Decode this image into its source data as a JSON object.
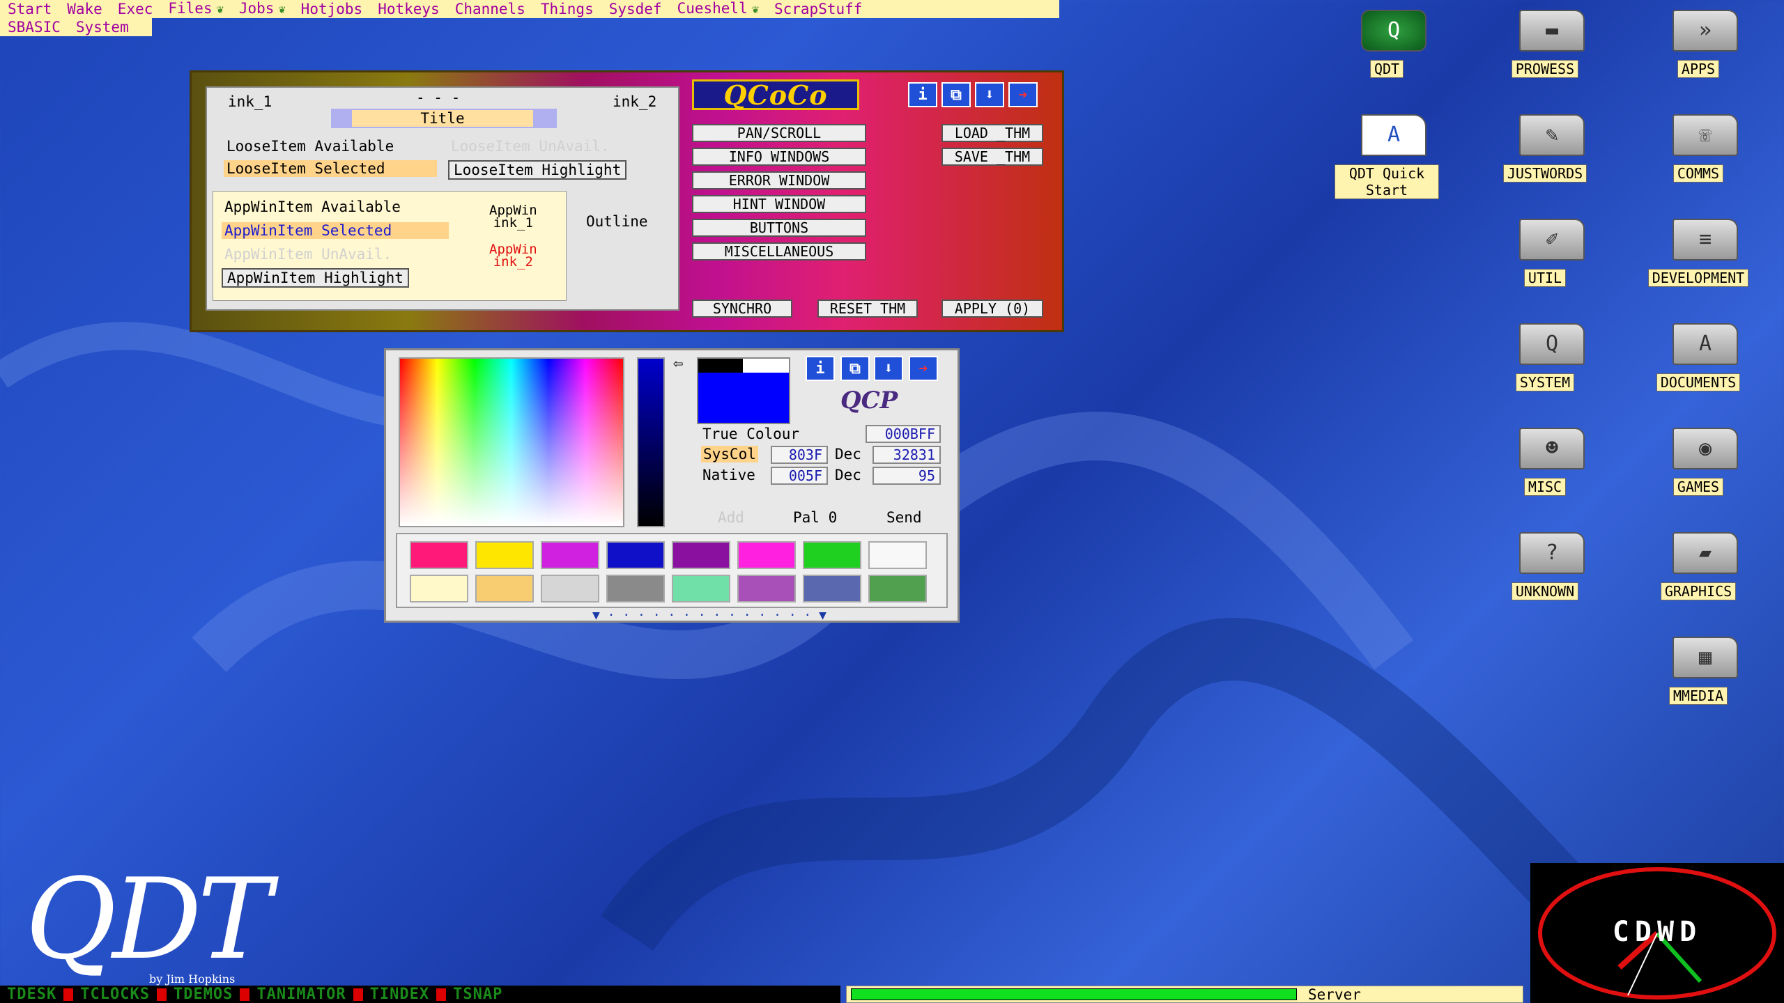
{
  "menu": {
    "row1": [
      "Start",
      "Wake",
      "Exec",
      "Files",
      "Jobs",
      "Hotjobs",
      "Hotkeys",
      "Channels",
      "Things",
      "Sysdef",
      "Cueshell",
      "ScrapStuff"
    ],
    "row1_leaf": {
      "Files": true,
      "Jobs": true,
      "Cueshell": true
    },
    "row2": [
      "SBASIC",
      "System"
    ]
  },
  "theme": {
    "ink1": "ink_1",
    "dashes": "- - -",
    "ink2": "ink_2",
    "title": "Title",
    "loose_available": "LooseItem Available",
    "loose_unavail": "LooseItem UnAvail.",
    "loose_selected": "LooseItem Selected",
    "loose_highlight": "LooseItem Highlight",
    "app_available": "AppWinItem Available",
    "app_selected": "AppWinItem Selected",
    "app_unavail": "AppWinItem UnAvail.",
    "app_highlight": "AppWinItem Highlight",
    "appwin_ink1": "AppWin\nink_1",
    "appwin_ink2": "AppWin\nink_2",
    "outline": "Outline",
    "logo": "QCoCo",
    "buttons": [
      "PAN/SCROLL",
      "INFO WINDOWS",
      "ERROR WINDOW",
      "HINT WINDOW",
      "BUTTONS",
      "MISCELLANEOUS"
    ],
    "load": "LOAD _THM",
    "save": "SAVE _THM",
    "synchro": "SYNCHRO",
    "reset": "RESET THM",
    "apply": "APPLY (0)"
  },
  "picker": {
    "logo": "QCP",
    "true_colour_label": "True Colour",
    "true_colour": "000BFF",
    "syscol_label": "SysCol",
    "syscol": "803F",
    "dec_label": "Dec",
    "syscol_dec": "32831",
    "native_label": "Native",
    "native": "005F",
    "native_dec": "95",
    "add": "Add",
    "pal": "Pal 0",
    "send": "Send",
    "swatches_row1": [
      "#ff1a7a",
      "#ffe600",
      "#d020e0",
      "#1010c8",
      "#8a10a0",
      "#ff20e0",
      "#20d020",
      "#f8f8f8"
    ],
    "swatches_row2": [
      "#fff8c8",
      "#f8cc70",
      "#d6d6d6",
      "#8a8a8a",
      "#70e0a8",
      "#a850b8",
      "#5a68b0",
      "#50a050"
    ]
  },
  "desktop_icons": [
    {
      "label": "QDT",
      "glyph": "Q",
      "type": "app"
    },
    {
      "label": "PROWESS",
      "glyph": "▬",
      "type": "folder"
    },
    {
      "label": "APPS",
      "glyph": "»",
      "type": "folder"
    },
    {
      "label": "QDT Quick Start",
      "glyph": "A",
      "type": "doc"
    },
    {
      "label": "JUSTWORDS",
      "glyph": "✎",
      "type": "folder"
    },
    {
      "label": "COMMS",
      "glyph": "☏",
      "type": "folder"
    },
    {
      "label": "UTIL",
      "glyph": "✐",
      "type": "folder"
    },
    {
      "label": "DEVELOPMENT",
      "glyph": "≡",
      "type": "folder"
    },
    {
      "label": "SYSTEM",
      "glyph": "Q",
      "type": "folder"
    },
    {
      "label": "DOCUMENTS",
      "glyph": "A",
      "type": "folder"
    },
    {
      "label": "MISC",
      "glyph": "☻",
      "type": "folder"
    },
    {
      "label": "GAMES",
      "glyph": "◉",
      "type": "folder"
    },
    {
      "label": "UNKNOWN",
      "glyph": "?",
      "type": "folder"
    },
    {
      "label": "GRAPHICS",
      "glyph": "▰",
      "type": "folder"
    },
    {
      "label": "MMEDIA",
      "glyph": "▦",
      "type": "folder"
    }
  ],
  "taskbar": [
    "TDESK",
    "TCLOCKS",
    "TDEMOS",
    "TANIMATOR",
    "TINDEX",
    "TSNAP"
  ],
  "server_label": "Server",
  "server_progress": 0.66,
  "logo_text": "QDT",
  "logo_sub": "by Jim Hopkins",
  "clock_text": "CDWD"
}
